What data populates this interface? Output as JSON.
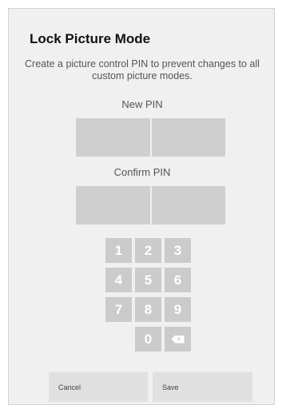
{
  "dialog": {
    "title": "Lock Picture Mode",
    "description": "Create a picture control PIN to prevent changes to all custom picture modes.",
    "new_pin_label": "New PIN",
    "confirm_pin_label": "Confirm PIN",
    "new_pin_digits": [
      "",
      ""
    ],
    "confirm_pin_digits": [
      "",
      ""
    ]
  },
  "keypad": {
    "keys": [
      "1",
      "2",
      "3",
      "4",
      "5",
      "6",
      "7",
      "8",
      "9",
      "0"
    ],
    "backspace_icon": "backspace-icon"
  },
  "actions": {
    "cancel_label": "Cancel",
    "save_label": "Save"
  },
  "colors": {
    "background": "#f0f0f0",
    "pin_box": "#cfcfcf",
    "key": "#cbcbcb",
    "button": "#e0e0e0"
  }
}
